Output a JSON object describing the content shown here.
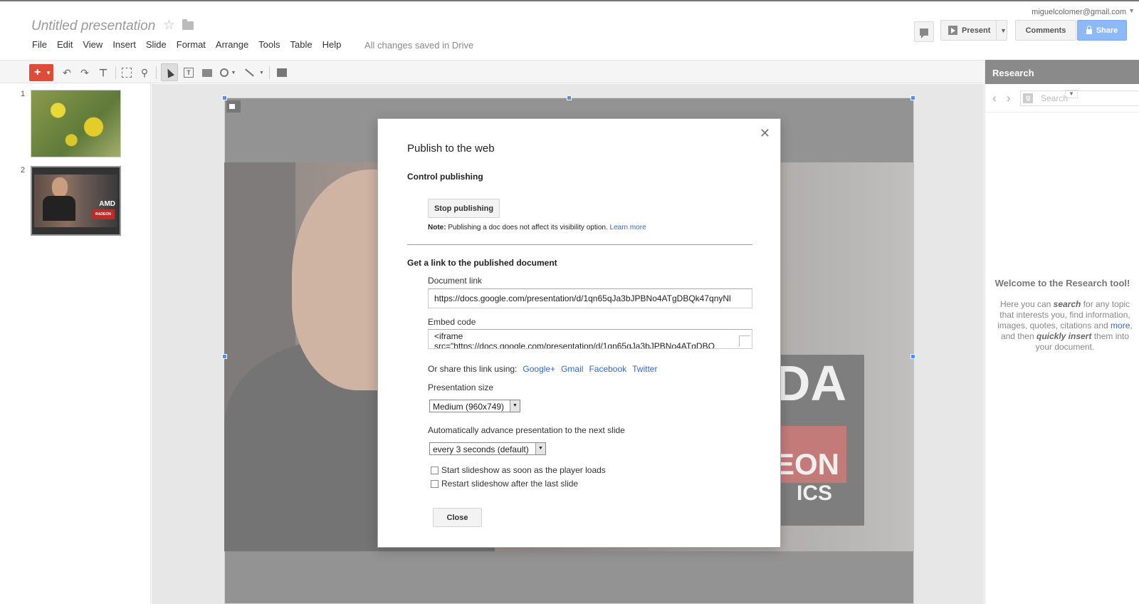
{
  "header": {
    "doc_title": "Untitled presentation",
    "saved_status": "All changes saved in Drive",
    "account": "miguelcolomer@gmail.com",
    "present_label": "Present",
    "comments_label": "Comments",
    "share_label": "Share"
  },
  "menu": [
    "File",
    "Edit",
    "View",
    "Insert",
    "Slide",
    "Format",
    "Arrange",
    "Tools",
    "Table",
    "Help"
  ],
  "filmstrip": {
    "slides": [
      {
        "number": "1"
      },
      {
        "number": "2",
        "logo_text": "AMD",
        "badge_text": "RADEON"
      }
    ]
  },
  "slide_photo_text": {
    "logo": "DA",
    "line1": "EON",
    "line2": "ICS"
  },
  "research": {
    "title": "Research",
    "search_placeholder": "Search",
    "welcome_title": "Welcome to the Research tool!",
    "welcome_p1": "Here you can ",
    "welcome_search": "search",
    "welcome_p2": " for any topic that interests you, find information, images, quotes, citations and ",
    "welcome_more": "more",
    "welcome_p3": ", and then ",
    "welcome_insert": "quickly insert",
    "welcome_p4": " them into your document."
  },
  "dialog": {
    "title": "Publish to the web",
    "control_heading": "Control publishing",
    "stop_button": "Stop publishing",
    "note_label": "Note:",
    "note_text": " Publishing a doc does not affect its visibility option. ",
    "learn_more": "Learn more",
    "link_heading": "Get a link to the published document",
    "document_link_label": "Document link",
    "document_link_value": "https://docs.google.com/presentation/d/1qn65qJa3bJPBNo4ATgDBQk47qnyNl",
    "embed_label": "Embed code",
    "embed_line1": "<iframe",
    "embed_line2": "src=\"https://docs.google.com/presentation/d/1qn65qJa3bJPBNo4ATgDBQ",
    "share_prefix": "Or share this link using:",
    "share_links": [
      "Google+",
      "Gmail",
      "Facebook",
      "Twitter"
    ],
    "size_label": "Presentation size",
    "size_value": "Medium (960x749)",
    "advance_label": "Automatically advance presentation to the next slide",
    "advance_value": "every 3 seconds (default)",
    "check_start": "Start slideshow as soon as the player loads",
    "check_restart": "Restart slideshow after the last slide",
    "close_button": "Close"
  }
}
